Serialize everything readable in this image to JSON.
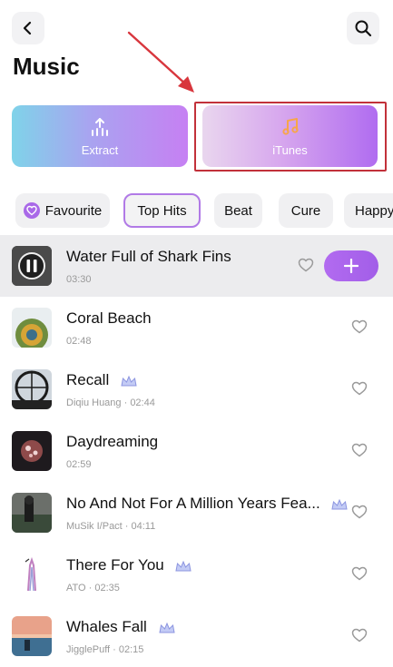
{
  "header": {
    "title": "Music",
    "back_icon": "back-chevron-icon",
    "search_icon": "search-icon"
  },
  "source_cards": [
    {
      "label": "Extract",
      "icon": "extract-upload-icon"
    },
    {
      "label": "iTunes",
      "icon": "music-note-icon"
    }
  ],
  "categories": [
    {
      "label": "Favourite",
      "icon": "heart-icon",
      "selected": false
    },
    {
      "label": "Top Hits",
      "selected": true
    },
    {
      "label": "Beat",
      "selected": false
    },
    {
      "label": "Cure",
      "selected": false
    },
    {
      "label": "Happy",
      "selected": false
    }
  ],
  "songs": [
    {
      "title": "Water Full of Shark Fins",
      "subtitle": "03:30",
      "premium": false,
      "playing": true
    },
    {
      "title": "Coral Beach",
      "subtitle": "02:48",
      "premium": false
    },
    {
      "title": "Recall",
      "subtitle": "Diqiu Huang · 02:44",
      "premium": true
    },
    {
      "title": "Daydreaming",
      "subtitle": "02:59",
      "premium": false
    },
    {
      "title": "No And Not For A Million Years Fea...",
      "subtitle": "MuSik I/Pact · 04:11",
      "premium": true
    },
    {
      "title": "There For You",
      "subtitle": "ATO · 02:35",
      "premium": true
    },
    {
      "title": "Whales Fall",
      "subtitle": "JigglePuff · 02:15",
      "premium": true
    }
  ],
  "colors": {
    "accent": "#a969e8",
    "highlight_box": "#c2313a",
    "playing_row_bg": "#ececee"
  }
}
